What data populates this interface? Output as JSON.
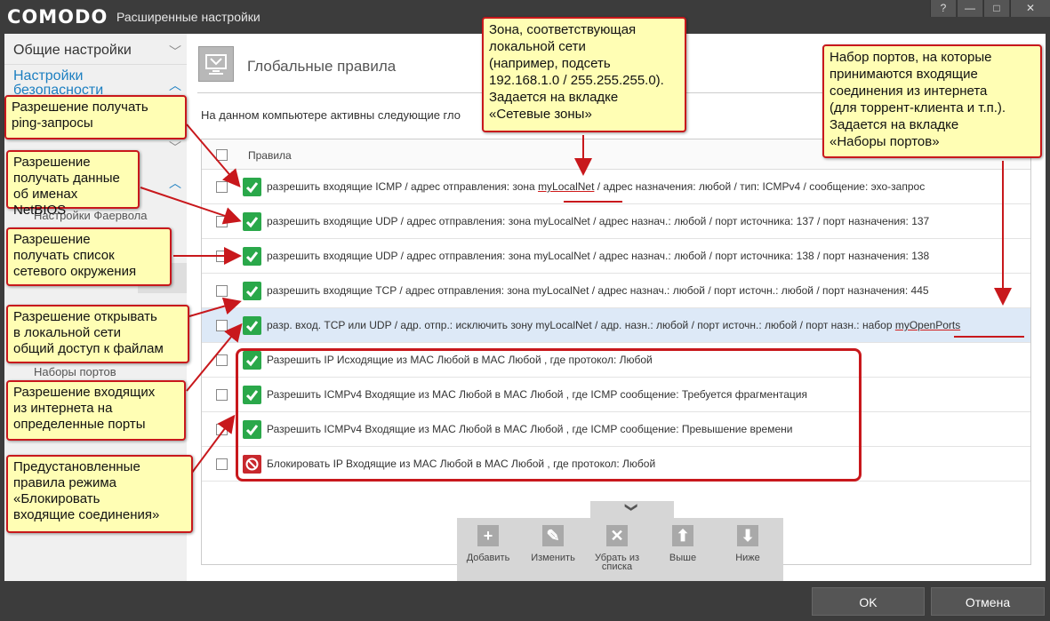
{
  "window": {
    "logo": "COMODO",
    "title": "Расширенные настройки",
    "buttons": [
      "?",
      "—",
      "□",
      "✕"
    ]
  },
  "sidebar": {
    "items": [
      {
        "label": "Общие настройки"
      },
      {
        "label": "Настройки безопасности"
      },
      {
        "label": "Настройки Фаервола"
      },
      {
        "label": "Наборы портов"
      }
    ]
  },
  "header": {
    "title": "Глобальные правила",
    "intro": "На данном компьютере активны следующие гло"
  },
  "table": {
    "column": "Правила",
    "rows": [
      {
        "type": "allow",
        "text_before": "разрешить входящие ICMP / адрес отправления: зона ",
        "highlight": "myLocalNet",
        "text_after": " / адрес назначения: любой / тип: ICMPv4 / сообщение: эхо-запрос"
      },
      {
        "type": "allow",
        "text": "разрешить входящие UDP / адрес отправления: зона myLocalNet / адрес назнач.: любой / порт источника: 137 / порт назначения: 137"
      },
      {
        "type": "allow",
        "text": "разрешить входящие UDP / адрес отправления: зона myLocalNet / адрес назнач.: любой / порт источника: 138 / порт назначения: 138"
      },
      {
        "type": "allow",
        "text": "разрешить входящие TCP / адрес отправления: зона myLocalNet / адрес назнач.: любой / порт источн.: любой / порт назначения: 445"
      },
      {
        "type": "allow",
        "selected": true,
        "text_before": "разр. вход. TCP или UDP / адр. отпр.: исключить зону myLocalNet / адр. назн.: любой / порт источн.: любой / порт назн.: набор ",
        "highlight": "myOpenPorts",
        "text_after": ""
      },
      {
        "type": "allow",
        "text": "Разрешить IP Исходящие из MAC Любой в MAC Любой , где протокол: Любой"
      },
      {
        "type": "allow",
        "text": "Разрешить ICMPv4 Входящие из MAC Любой в MAC Любой , где ICMP сообщение: Требуется фрагментация"
      },
      {
        "type": "allow",
        "text": "Разрешить ICMPv4 Входящие из MAC Любой в MAC Любой , где ICMP сообщение: Превышение времени"
      },
      {
        "type": "block",
        "text": "Блокировать IP Входящие из MAC Любой в MAC Любой , где протокол: Любой"
      }
    ]
  },
  "toolbar": {
    "expand": "❯",
    "add": "Добавить",
    "edit": "Изменить",
    "remove_1": "Убрать из",
    "remove_2": "списка",
    "up": "Выше",
    "down": "Ниже"
  },
  "footer": {
    "ok": "OK",
    "cancel": "Отмена"
  },
  "callouts": {
    "ping": [
      "Разрешение получать",
      "ping-запросы"
    ],
    "netbios": [
      "Разрешение",
      "получать данные",
      "об именах NetBIOS"
    ],
    "network_list": [
      "Разрешение",
      "получать список",
      "сетевого окружения"
    ],
    "file_share": [
      "Разрешение открывать",
      "в локальной сети",
      "общий доступ к файлам"
    ],
    "inbound_ports": [
      "Разрешение входящих",
      "из интернета на",
      "определенные порты"
    ],
    "preset": [
      "Предустановленные",
      "правила режима",
      "«Блокировать",
      "входящие соединения»"
    ],
    "zone": [
      "Зона, соответствующая",
      "локальной сети",
      "(например, подсеть",
      "192.168.1.0 / 255.255.255.0).",
      "Задается на вкладке",
      "«Сетевые зоны»"
    ],
    "port_sets": [
      "Набор портов, на которые",
      "принимаются входящие",
      "соединения из интернета",
      "(для торрент-клиента и т.п.).",
      "Задается на вкладке",
      "«Наборы портов»"
    ]
  },
  "colors": {
    "allow": "#2aa84a",
    "block": "#c8282d",
    "callout_bg": "#fffeb4",
    "callout_border": "#c8181c",
    "accent": "#1c7fc1"
  }
}
